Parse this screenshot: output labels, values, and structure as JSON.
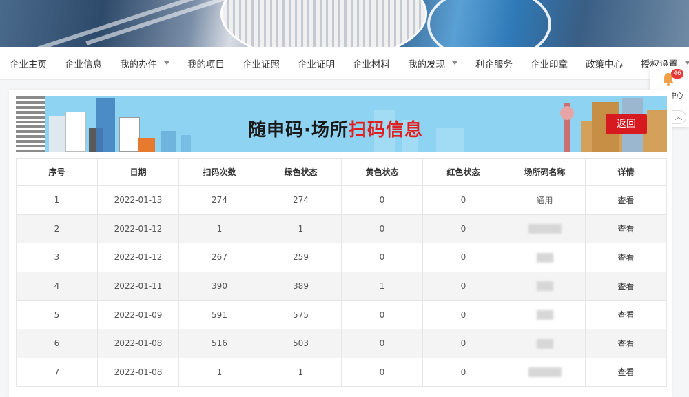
{
  "nav": {
    "items": [
      {
        "label": "企业主页",
        "dropdown": false
      },
      {
        "label": "企业信息",
        "dropdown": false
      },
      {
        "label": "我的办件",
        "dropdown": true
      },
      {
        "label": "我的项目",
        "dropdown": false
      },
      {
        "label": "企业证照",
        "dropdown": false
      },
      {
        "label": "企业证明",
        "dropdown": false
      },
      {
        "label": "企业材料",
        "dropdown": false
      },
      {
        "label": "我的发现",
        "dropdown": true
      },
      {
        "label": "利企服务",
        "dropdown": false
      },
      {
        "label": "企业印章",
        "dropdown": false
      },
      {
        "label": "政策中心",
        "dropdown": false
      },
      {
        "label": "授权设置",
        "dropdown": true
      }
    ]
  },
  "side": {
    "badge_count": "46",
    "message_label": "消息中心",
    "collapse_label": "收起"
  },
  "banner": {
    "title_black": "随申码·场所",
    "title_red": "扫码信息",
    "back_label": "返回"
  },
  "table": {
    "headers": [
      "序号",
      "日期",
      "扫码次数",
      "绿色状态",
      "黄色状态",
      "红色状态",
      "场所码名称",
      "详情"
    ],
    "rows": [
      {
        "no": "1",
        "date": "2022-01-13",
        "scans": "274",
        "green": "274",
        "yellow": "0",
        "red": "0",
        "name": "通用",
        "detail": "查看"
      },
      {
        "no": "2",
        "date": "2022-01-12",
        "scans": "1",
        "green": "1",
        "yellow": "0",
        "red": "0",
        "name": "",
        "detail": "查看"
      },
      {
        "no": "3",
        "date": "2022-01-12",
        "scans": "267",
        "green": "259",
        "yellow": "0",
        "red": "0",
        "name": "",
        "detail": "查看"
      },
      {
        "no": "4",
        "date": "2022-01-11",
        "scans": "390",
        "green": "389",
        "yellow": "1",
        "red": "0",
        "name": "",
        "detail": "查看"
      },
      {
        "no": "5",
        "date": "2022-01-09",
        "scans": "591",
        "green": "575",
        "yellow": "0",
        "red": "0",
        "name": "",
        "detail": "查看"
      },
      {
        "no": "6",
        "date": "2022-01-08",
        "scans": "516",
        "green": "503",
        "yellow": "0",
        "red": "0",
        "name": "",
        "detail": "查看"
      },
      {
        "no": "7",
        "date": "2022-01-08",
        "scans": "1",
        "green": "1",
        "yellow": "0",
        "red": "0",
        "name": "",
        "detail": "查看"
      }
    ]
  },
  "colors": {
    "accent_red": "#d71920",
    "banner_sky": "#8fd3f2",
    "badge_red": "#e53935"
  }
}
